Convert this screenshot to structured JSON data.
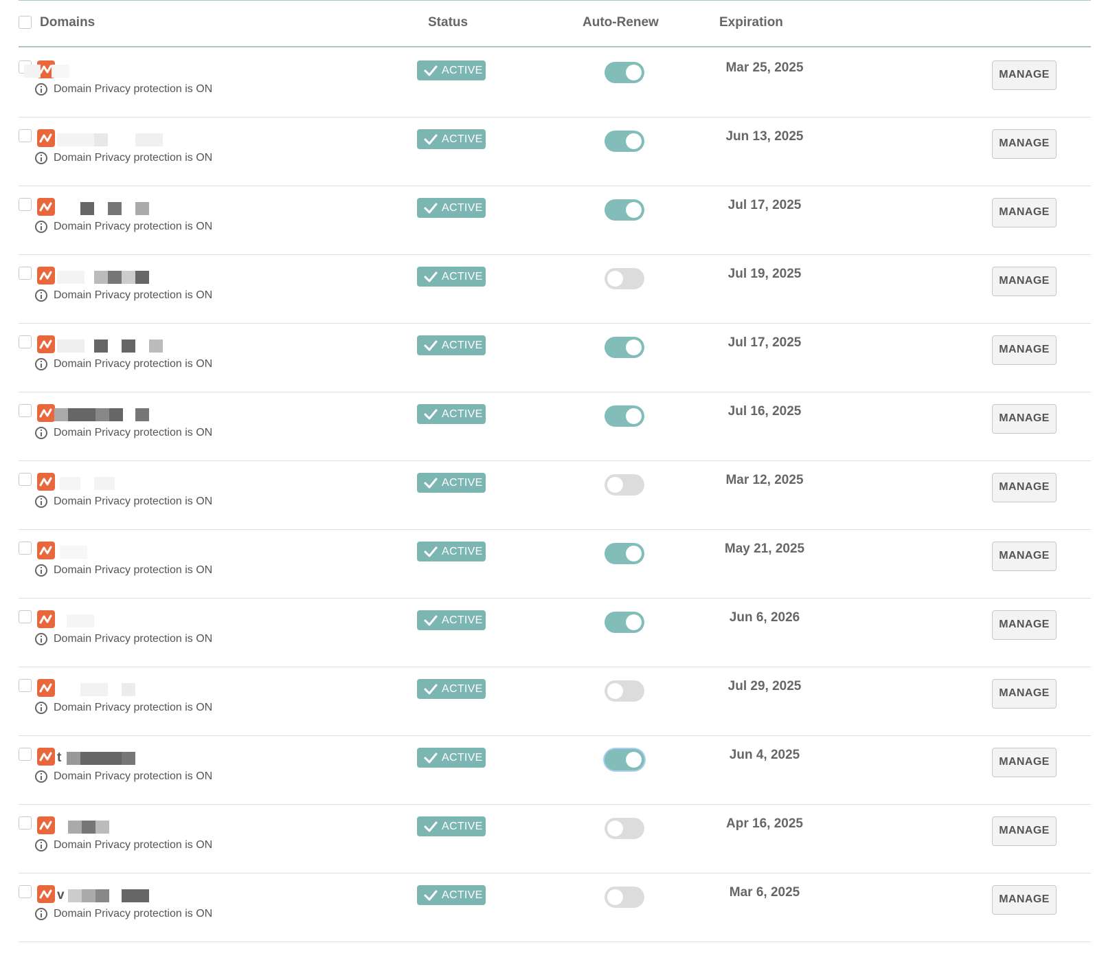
{
  "header": {
    "domains_label": "Domains",
    "status_label": "Status",
    "auto_renew_label": "Auto-Renew",
    "expiration_label": "Expiration"
  },
  "colors": {
    "accent_teal": "#7bb6b3",
    "brand_orange": "#e8673c",
    "toggle_off": "#dcdcdc"
  },
  "rows": [
    {
      "domain": "",
      "privacy": "Domain Privacy protection is ON",
      "status": "ACTIVE",
      "auto_renew": true,
      "expiration": "Mar 25, 2025",
      "manage": "MANAGE"
    },
    {
      "domain": "",
      "privacy": "Domain Privacy protection is ON",
      "status": "ACTIVE",
      "auto_renew": true,
      "expiration": "Jun 13, 2025",
      "manage": "MANAGE"
    },
    {
      "domain": "",
      "privacy": "Domain Privacy protection is ON",
      "status": "ACTIVE",
      "auto_renew": true,
      "expiration": "Jul 17, 2025",
      "manage": "MANAGE"
    },
    {
      "domain": "",
      "privacy": "Domain Privacy protection is ON",
      "status": "ACTIVE",
      "auto_renew": false,
      "expiration": "Jul 19, 2025",
      "manage": "MANAGE"
    },
    {
      "domain": "",
      "privacy": "Domain Privacy protection is ON",
      "status": "ACTIVE",
      "auto_renew": true,
      "expiration": "Jul 17, 2025",
      "manage": "MANAGE"
    },
    {
      "domain": "",
      "privacy": "Domain Privacy protection is ON",
      "status": "ACTIVE",
      "auto_renew": true,
      "expiration": "Jul 16, 2025",
      "manage": "MANAGE"
    },
    {
      "domain": "",
      "privacy": "Domain Privacy protection is ON",
      "status": "ACTIVE",
      "auto_renew": false,
      "expiration": "Mar 12, 2025",
      "manage": "MANAGE"
    },
    {
      "domain": "",
      "privacy": "Domain Privacy protection is ON",
      "status": "ACTIVE",
      "auto_renew": true,
      "expiration": "May 21, 2025",
      "manage": "MANAGE"
    },
    {
      "domain": "",
      "privacy": "Domain Privacy protection is ON",
      "status": "ACTIVE",
      "auto_renew": true,
      "expiration": "Jun 6, 2026",
      "manage": "MANAGE"
    },
    {
      "domain": "",
      "privacy": "Domain Privacy protection is ON",
      "status": "ACTIVE",
      "auto_renew": false,
      "expiration": "Jul 29, 2025",
      "manage": "MANAGE"
    },
    {
      "domain": "t",
      "privacy": "Domain Privacy protection is ON",
      "status": "ACTIVE",
      "auto_renew": true,
      "expiration": "Jun 4, 2025",
      "manage": "MANAGE"
    },
    {
      "domain": "",
      "privacy": "Domain Privacy protection is ON",
      "status": "ACTIVE",
      "auto_renew": false,
      "expiration": "Apr 16, 2025",
      "manage": "MANAGE"
    },
    {
      "domain": "v",
      "privacy": "Domain Privacy protection is ON",
      "status": "ACTIVE",
      "auto_renew": false,
      "expiration": "Mar 6, 2025",
      "manage": "MANAGE"
    }
  ]
}
